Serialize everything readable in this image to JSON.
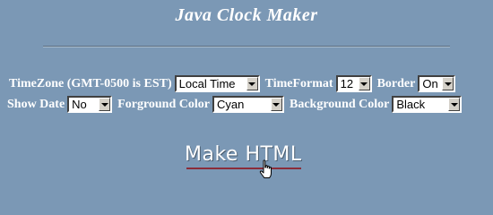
{
  "page": {
    "title": "Java Clock Maker"
  },
  "form": {
    "timezone": {
      "label": "TimeZone (GMT-0500 is EST)",
      "selected": "Local Time"
    },
    "timeformat": {
      "label": "TimeFormat",
      "selected": "12"
    },
    "border": {
      "label": "Border",
      "selected": "On"
    },
    "show_date": {
      "label": "Show Date",
      "selected": "No"
    },
    "foreground_color": {
      "label": "Forground Color",
      "selected": "Cyan"
    },
    "background_color": {
      "label": "Background Color",
      "selected": "Black"
    }
  },
  "actions": {
    "make_html": "Make HTML"
  },
  "icons": {
    "dropdown": "chevron-down-icon",
    "pointer": "hand-pointer-cursor-icon"
  },
  "colors": {
    "background": "#7b98b5",
    "text": "#ffffff",
    "underline": "#8a2d3a"
  }
}
